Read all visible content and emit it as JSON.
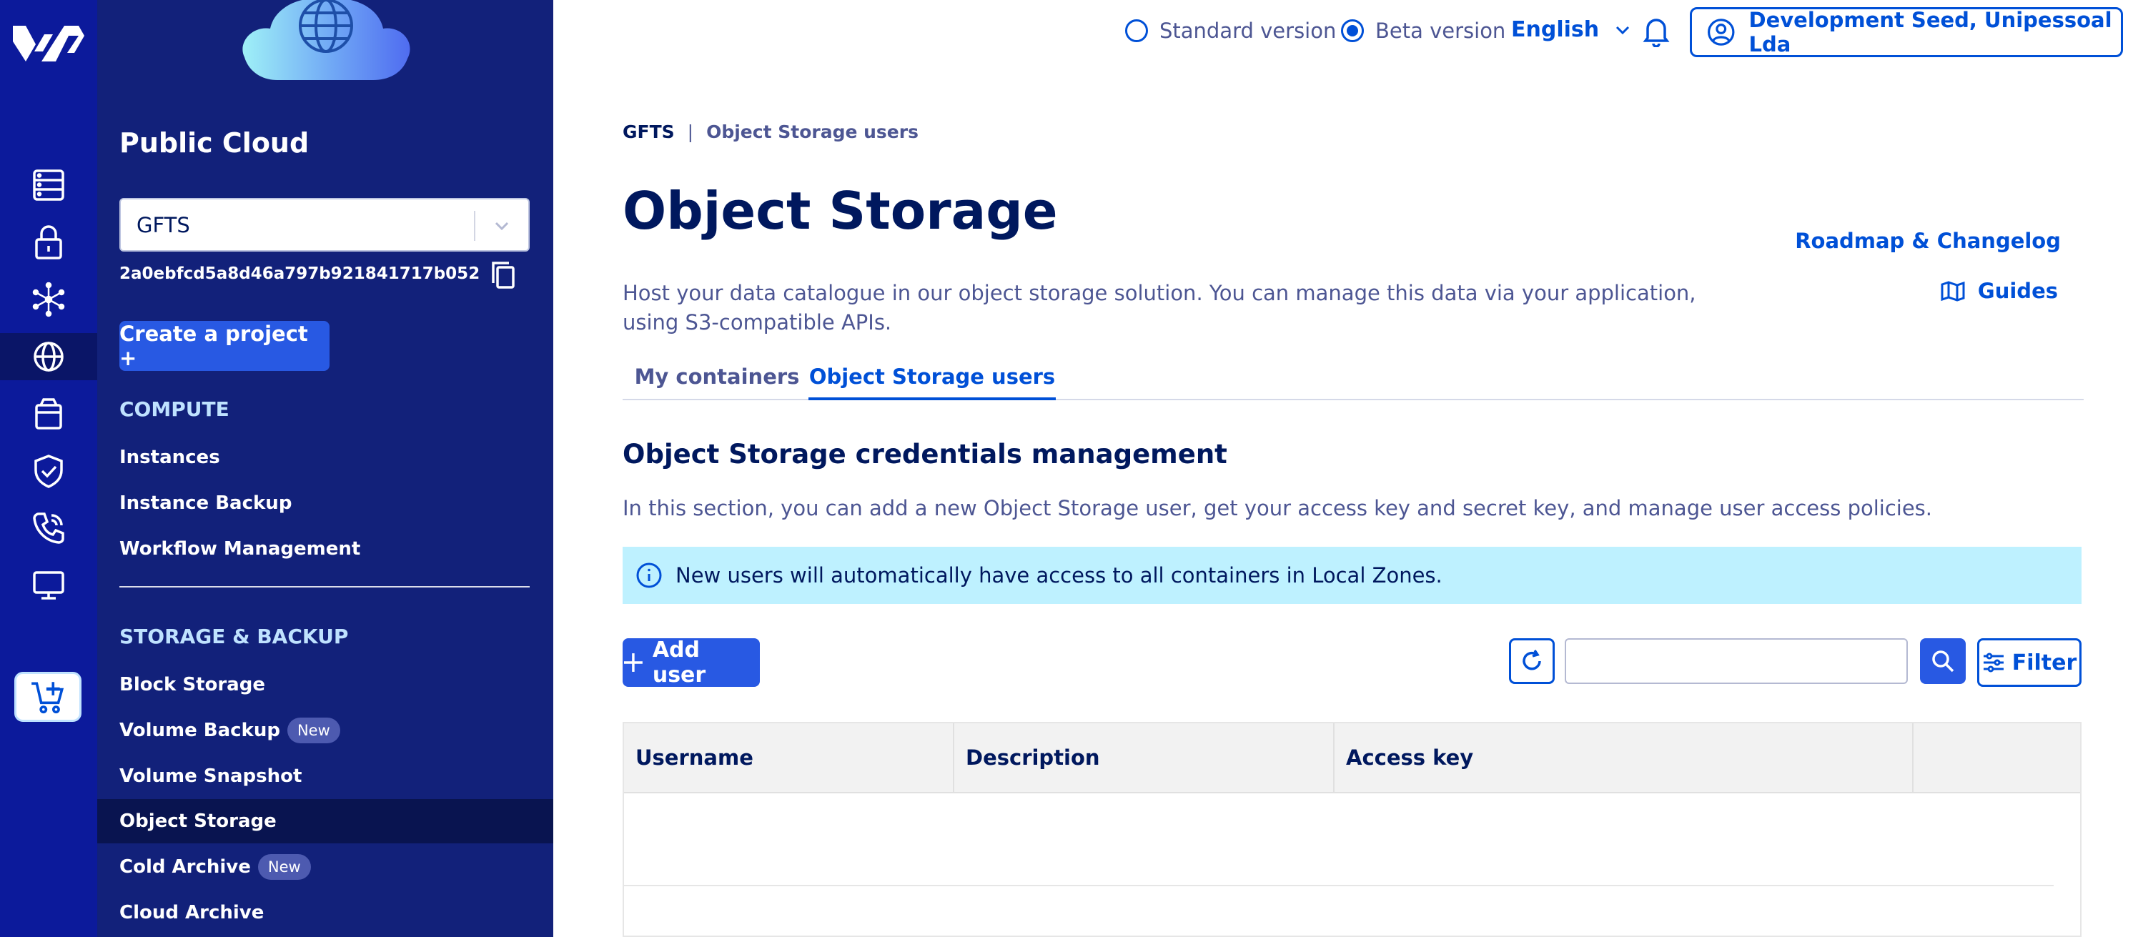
{
  "rail": {
    "items": [
      {
        "name": "bare-metal-icon"
      },
      {
        "name": "lock-icon"
      },
      {
        "name": "network-icon"
      },
      {
        "name": "globe-icon"
      },
      {
        "name": "package-icon"
      },
      {
        "name": "shield-icon"
      },
      {
        "name": "phone-icon"
      },
      {
        "name": "monitor-icon"
      }
    ],
    "active_item": "globe-icon",
    "cart_icon": "cart-plus-icon"
  },
  "sidebar": {
    "title": "Public Cloud",
    "project_select_value": "GFTS",
    "project_id": "2a0ebfcd5a8d46a797b921841717b052",
    "create_project_label": "Create a project +",
    "sections": [
      {
        "label": "COMPUTE",
        "items": [
          {
            "label": "Instances"
          },
          {
            "label": "Instance Backup"
          },
          {
            "label": "Workflow Management"
          }
        ]
      },
      {
        "label": "STORAGE & BACKUP",
        "items": [
          {
            "label": "Block Storage"
          },
          {
            "label": "Volume Backup",
            "badge": "New"
          },
          {
            "label": "Volume Snapshot"
          },
          {
            "label": "Object Storage",
            "active": true
          },
          {
            "label": "Cold Archive",
            "badge": "New"
          },
          {
            "label": "Cloud Archive"
          }
        ]
      }
    ]
  },
  "topbar": {
    "standard_label": "Standard version",
    "beta_label": "Beta version",
    "selected_version": "beta",
    "language": "English",
    "account_label": "Development Seed, Unipessoal Lda"
  },
  "main": {
    "breadcrumb": {
      "root": "GFTS",
      "separator": "|",
      "current": "Object Storage users"
    },
    "title": "Object Storage",
    "roadmap_label": "Roadmap & Changelog",
    "guides_label": "Guides",
    "description": "Host your data catalogue in our object storage solution. You can manage this data via your application, using S3-compatible APIs.",
    "tabs": [
      {
        "label": "My containers"
      },
      {
        "label": "Object Storage users",
        "active": true
      }
    ],
    "section_title": "Object Storage credentials management",
    "section_desc": "In this section, you can add a new Object Storage user, get your access key and secret key, and manage user access policies.",
    "info_message": "New users will automatically have access to all containers in Local Zones.",
    "add_user_label": "Add user",
    "search_value": "",
    "filter_label": "Filter",
    "table": {
      "columns": [
        "Username",
        "Description",
        "Access key",
        ""
      ],
      "rows": []
    }
  },
  "colors": {
    "rail_bg": "#0c1a9b",
    "sidebar_bg": "#12217a",
    "primary": "#0050d7",
    "button": "#2859e3",
    "heading": "#00185e",
    "info_bg": "#bef1ff"
  }
}
